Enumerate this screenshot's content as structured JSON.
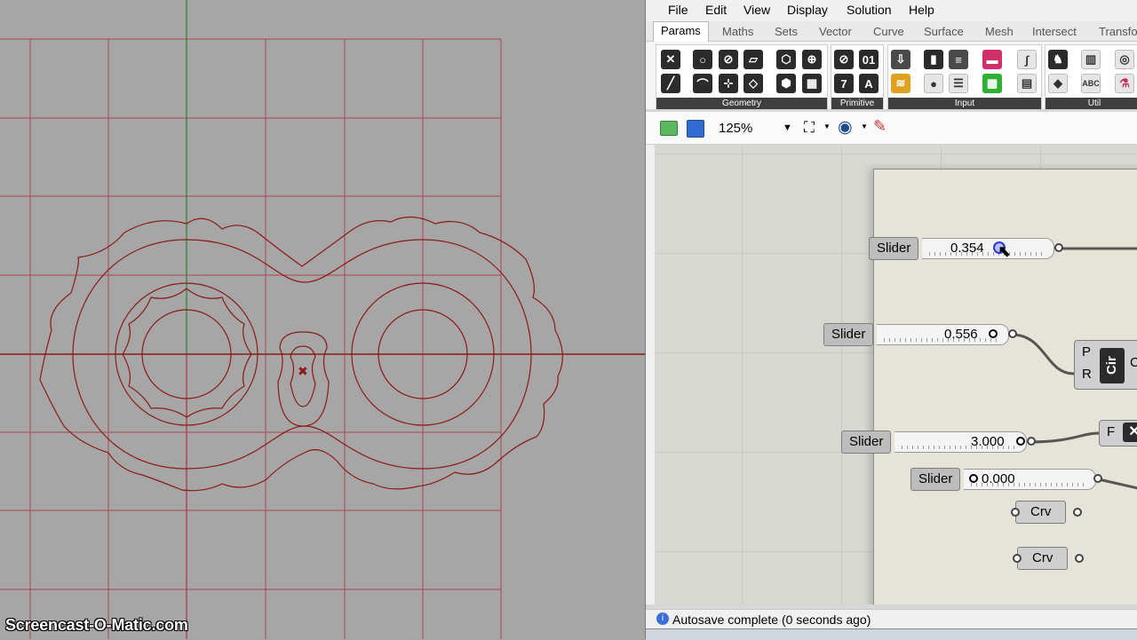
{
  "watermark": "Screencast-O-Matic.com",
  "menu": [
    "File",
    "Edit",
    "View",
    "Display",
    "Solution",
    "Help"
  ],
  "tabs": [
    "Params",
    "Maths",
    "Sets",
    "Vector",
    "Curve",
    "Surface",
    "Mesh",
    "Intersect",
    "Transfo"
  ],
  "ribbon_groups": [
    "Geometry",
    "Primitive",
    "Input",
    "Util"
  ],
  "toolbar": {
    "zoom": "125%"
  },
  "sliders": [
    {
      "label": "Slider",
      "value": "0.354"
    },
    {
      "label": "Slider",
      "value": "0.556"
    },
    {
      "label": "Slider",
      "value": "3.000"
    },
    {
      "label": "Slider",
      "value": "0.000"
    }
  ],
  "nodes": {
    "crv1": "Crv",
    "crv2": "Crv",
    "circle_inputs": [
      "P",
      "R"
    ],
    "circle_icon": "Cir",
    "circle_out": "C",
    "f_input": "F"
  },
  "status": "Autosave complete (0 seconds ago)",
  "colors": {
    "curve": "#8b1a1a",
    "grid": "#b03040",
    "axis_y": "#2e7d32",
    "viewport_bg": "#a6a6a6",
    "canvas_bg": "#d8d8d2"
  }
}
